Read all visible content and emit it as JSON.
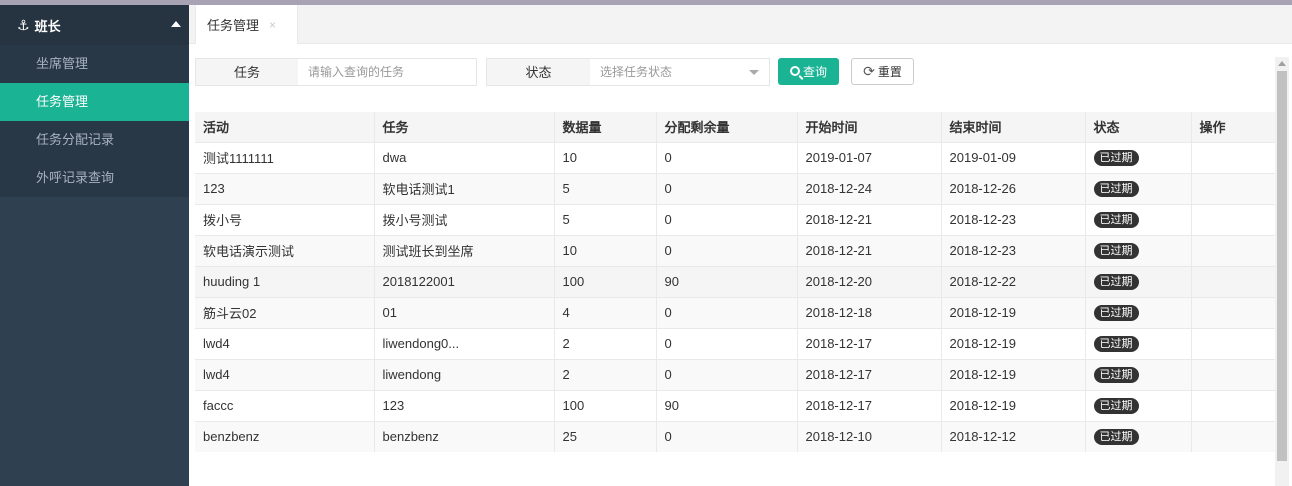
{
  "sidebar": {
    "header": "班长",
    "items": [
      {
        "label": "坐席管理",
        "active": false
      },
      {
        "label": "任务管理",
        "active": true
      },
      {
        "label": "任务分配记录",
        "active": false
      },
      {
        "label": "外呼记录查询",
        "active": false
      }
    ]
  },
  "tabs": [
    {
      "label": "任务管理",
      "close": "×"
    }
  ],
  "search": {
    "task_label": "任务",
    "task_placeholder": "请输入查询的任务",
    "status_label": "状态",
    "status_placeholder": "选择任务状态",
    "query_button": "查询",
    "reset_button": "重置"
  },
  "table": {
    "columns": [
      "活动",
      "任务",
      "数据量",
      "分配剩余量",
      "开始时间",
      "结束时间",
      "状态",
      "操作"
    ],
    "rows": [
      [
        "测试1111111",
        "dwa",
        "10",
        "0",
        "2019-01-07",
        "2019-01-09",
        "已过期",
        ""
      ],
      [
        "123",
        "软电话测试1",
        "5",
        "0",
        "2018-12-24",
        "2018-12-26",
        "已过期",
        ""
      ],
      [
        "拨小号",
        "拨小号测试",
        "5",
        "0",
        "2018-12-21",
        "2018-12-23",
        "已过期",
        ""
      ],
      [
        "软电话演示测试",
        "测试班长到坐席",
        "10",
        "0",
        "2018-12-21",
        "2018-12-23",
        "已过期",
        ""
      ],
      [
        "huuding 1",
        "2018122001",
        "100",
        "90",
        "2018-12-20",
        "2018-12-22",
        "已过期",
        ""
      ],
      [
        "筋斗云02",
        "01",
        "4",
        "0",
        "2018-12-18",
        "2018-12-19",
        "已过期",
        ""
      ],
      [
        "lwd4",
        "liwendong0...",
        "2",
        "0",
        "2018-12-17",
        "2018-12-19",
        "已过期",
        ""
      ],
      [
        "lwd4",
        "liwendong",
        "2",
        "0",
        "2018-12-17",
        "2018-12-19",
        "已过期",
        ""
      ],
      [
        "faccc",
        "123",
        "100",
        "90",
        "2018-12-17",
        "2018-12-19",
        "已过期",
        ""
      ],
      [
        "benzbenz",
        "benzbenz",
        "25",
        "0",
        "2018-12-10",
        "2018-12-12",
        "已过期",
        ""
      ]
    ]
  },
  "colors": {
    "accent": "#1ab394",
    "sidebar": "#2f4050",
    "badge": "#333333"
  }
}
